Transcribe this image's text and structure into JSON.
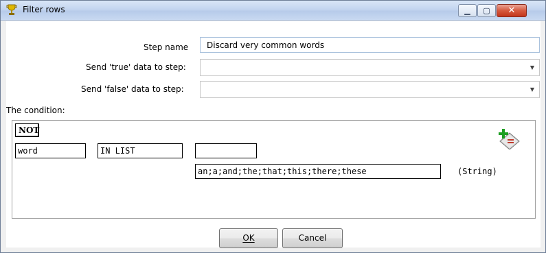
{
  "window": {
    "title": "Filter rows",
    "controls": {
      "minimize": "▁",
      "maximize": "▢",
      "close": "✕"
    }
  },
  "form": {
    "step_name_label": "Step name",
    "step_name_value": "Discard very common words",
    "true_step_label": "Send 'true' data to step:",
    "true_step_value": "",
    "false_step_label": "Send 'false' data to step:",
    "false_step_value": ""
  },
  "condition": {
    "label": "The condition:",
    "negation": "NOT",
    "field": "word",
    "function": "IN LIST",
    "compare_field": "",
    "value": "an;a;and;the;that;this;there;these",
    "value_type": "(String)"
  },
  "buttons": {
    "ok": "OK",
    "cancel": "Cancel"
  },
  "icons": {
    "app": "kettle-trophy-icon",
    "add_condition": "add-condition-icon"
  }
}
